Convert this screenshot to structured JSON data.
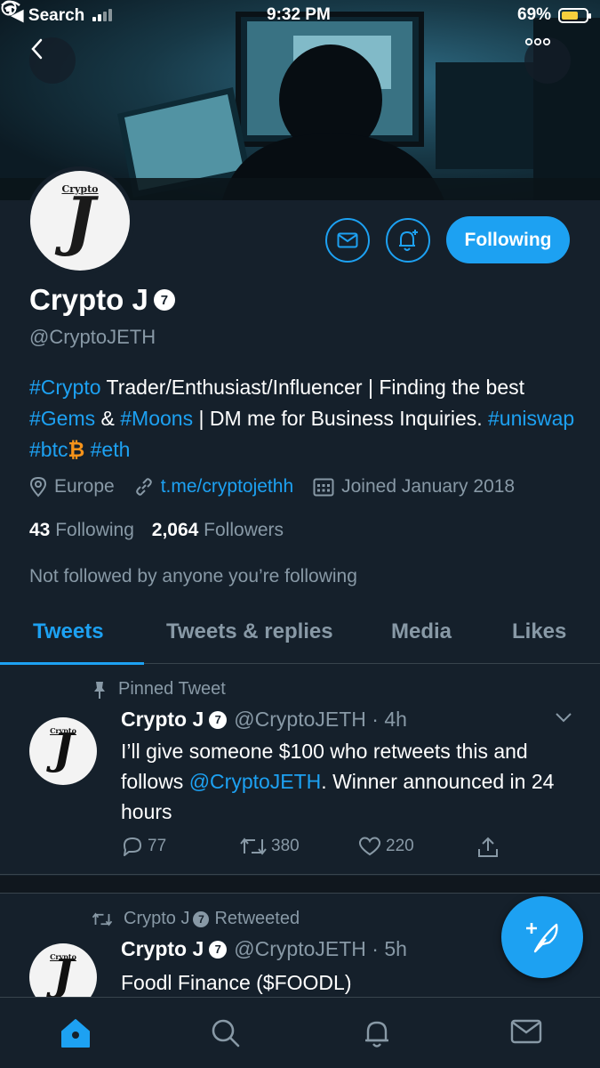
{
  "status_bar": {
    "back_app": "◀ Search",
    "time": "9:32 PM",
    "battery_percent": "69%",
    "battery_level": 0.69
  },
  "header": {
    "back_icon": "chevron-left-icon",
    "more_icon": "more-dots-icon"
  },
  "profile": {
    "avatar_caption": "Crypto",
    "avatar_letter": "J",
    "name": "Crypto J",
    "badge": "7",
    "handle": "@CryptoJETH",
    "bio": {
      "tag_crypto": "#Crypto",
      "text_1": " Trader/Enthusiast/Influencer | Finding the best ",
      "tag_gems": "#Gems",
      "text_2": " & ",
      "tag_moons": "#Moons",
      "text_3": " | DM me for Business Inquiries. ",
      "tag_uniswap": "#uniswap",
      "tag_btc": "#btc",
      "btc_symbol": "₿",
      "tag_eth": "#eth"
    },
    "location": "Europe",
    "link": "t.me/cryptojethh",
    "joined": "Joined January 2018",
    "following_count": "43",
    "following_label": "Following",
    "followers_count": "2,064",
    "followers_label": "Followers",
    "not_followed": "Not followed by anyone you’re following",
    "follow_button": "Following"
  },
  "tabs": [
    {
      "label": "Tweets",
      "active": true
    },
    {
      "label": "Tweets & replies",
      "active": false
    },
    {
      "label": "Media",
      "active": false
    },
    {
      "label": "Likes",
      "active": false
    }
  ],
  "tweets": [
    {
      "context": "Pinned Tweet",
      "name": "Crypto J",
      "badge": "7",
      "handle_time": "@CryptoJETH · 4h",
      "text_1": "I’ll give someone $100 who retweets this and follows ",
      "mention": "@CryptoJETH",
      "text_2": ". Winner announced in 24 hours",
      "replies": "77",
      "retweets": "380",
      "likes": "220"
    },
    {
      "context_name": "Crypto J",
      "context_badge": "7",
      "context_suffix": "Retweeted",
      "name": "Crypto J",
      "badge": "7",
      "handle_time": "@CryptoJETH · 5h",
      "text": "Foodl Finance ($FOODL)"
    }
  ],
  "colors": {
    "background": "#15202b",
    "accent": "#1da1f2",
    "secondary_text": "#8899a6",
    "btc_orange": "#f7931a"
  },
  "nav": [
    "home-icon",
    "search-icon",
    "notifications-icon",
    "messages-icon"
  ]
}
